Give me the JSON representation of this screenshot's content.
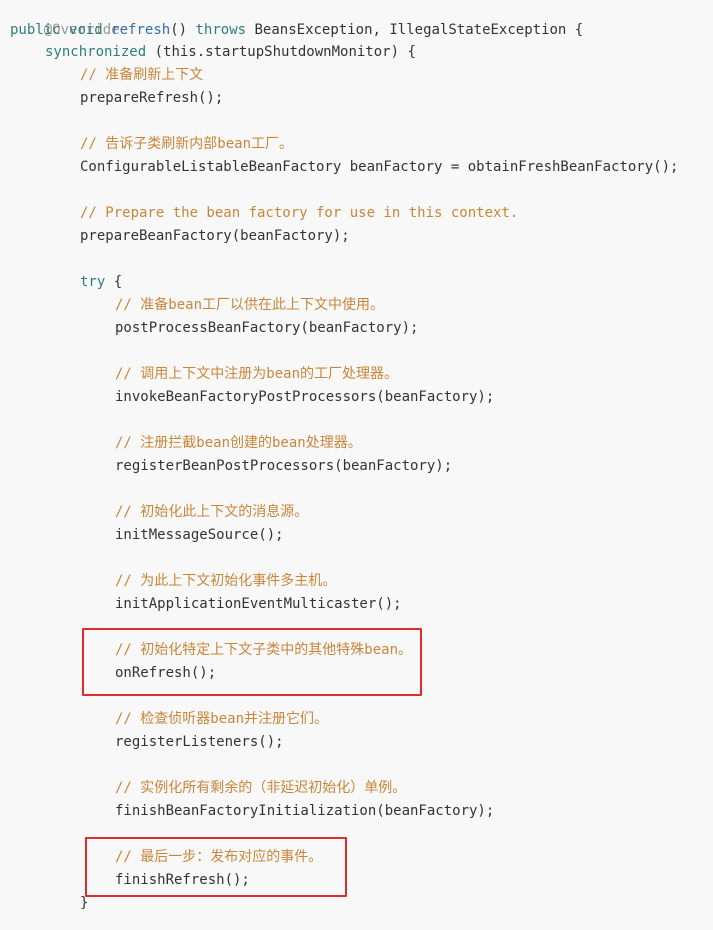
{
  "code": {
    "annotation": "@Override",
    "signature": {
      "kw_public": "public",
      "kw_void": "void",
      "method_name": "refresh",
      "params": "()",
      "kw_throws": "throws",
      "exceptions": "BeansException, IllegalStateException {"
    },
    "sync": {
      "keyword": "synchronized",
      "rest": " (this.startupShutdownMonitor) {"
    },
    "lines": {
      "c_prepare_refresh": "// 准备刷新上下文",
      "s_prepare_refresh": "prepareRefresh();",
      "c_obtain_factory": "// 告诉子类刷新内部bean工厂。",
      "s_obtain_factory": "ConfigurableListableBeanFactory beanFactory = obtainFreshBeanFactory();",
      "c_prepare_factory": "// Prepare the bean factory for use in this context.",
      "s_prepare_factory": "prepareBeanFactory(beanFactory);",
      "kw_try": "try",
      "try_brace": " {",
      "c_post_process": "// 准备bean工厂以供在此上下文中使用。",
      "s_post_process": "postProcessBeanFactory(beanFactory);",
      "c_invoke_pp": "// 调用上下文中注册为bean的工厂处理器。",
      "s_invoke_pp": "invokeBeanFactoryPostProcessors(beanFactory);",
      "c_register_bpp": "// 注册拦截bean创建的bean处理器。",
      "s_register_bpp": "registerBeanPostProcessors(beanFactory);",
      "c_init_message": "// 初始化此上下文的消息源。",
      "s_init_message": "initMessageSource();",
      "c_init_multicaster": "// 为此上下文初始化事件多主机。",
      "s_init_multicaster": "initApplicationEventMulticaster();",
      "c_on_refresh": "// 初始化特定上下文子类中的其他特殊bean。",
      "s_on_refresh": "onRefresh();",
      "c_register_listeners": "// 检查侦听器bean并注册它们。",
      "s_register_listeners": "registerListeners();",
      "c_finish_init": "// 实例化所有剩余的（非延迟初始化）单例。",
      "s_finish_init": "finishBeanFactoryInitialization(beanFactory);",
      "c_finish_refresh": "// 最后一步：发布对应的事件。",
      "s_finish_refresh": "finishRefresh();",
      "close_brace": "}"
    }
  },
  "colors": {
    "keyword": "#2f7d7d",
    "function": "#2f6fb0",
    "comment": "#c8863a",
    "annotation": "#999999",
    "highlight_border": "#e02b2b",
    "background": "#f8f8f8"
  }
}
